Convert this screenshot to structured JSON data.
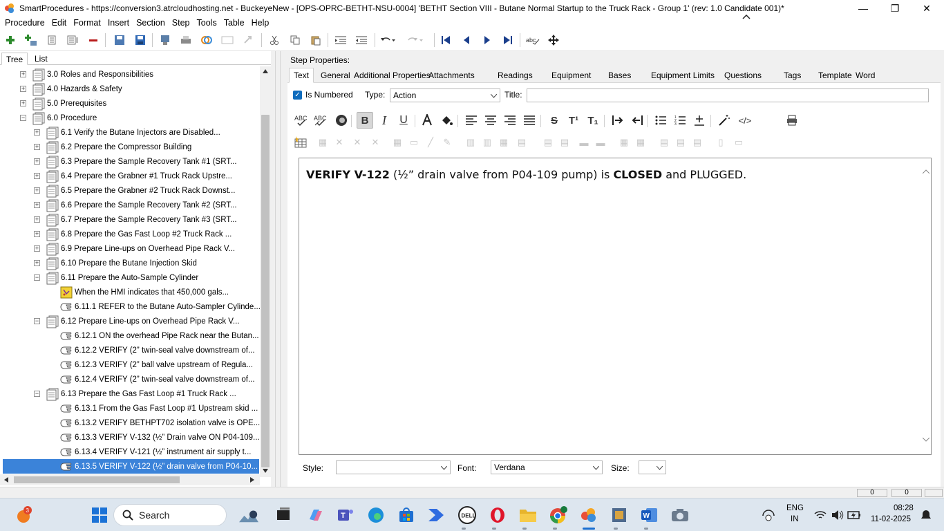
{
  "window": {
    "title": "SmartProcedures - https://conversion3.atrcloudhosting.net - BuckeyeNew - [OPS-OPRC-BETHT-NSU-0004] 'BETHT Section VIII - Butane Normal Startup to the Truck Rack - Group 1' (rev: 1.0 Candidate 001)*",
    "minimize": "—",
    "maximize": "❐",
    "close": "✕"
  },
  "menu": {
    "procedure": "Procedure",
    "edit": "Edit",
    "format": "Format",
    "insert": "Insert",
    "section": "Section",
    "step": "Step",
    "tools": "Tools",
    "table": "Table",
    "help": "Help"
  },
  "left_tabs": {
    "tree": "Tree",
    "list": "List"
  },
  "tree": {
    "rows": [
      {
        "label": "3.0 Roles and Responsibilities",
        "expander": "+",
        "icon": "section-icon"
      },
      {
        "label": "4.0 Hazards & Safety",
        "expander": "+",
        "icon": "section-icon"
      },
      {
        "label": "5.0 Prerequisites",
        "expander": "+",
        "icon": "section-icon"
      },
      {
        "label": "6.0 Procedure",
        "expander": "−",
        "icon": "section-icon"
      },
      {
        "label": "6.1 Verify the Butane Injectors are Disabled...",
        "expander": "+",
        "icon": "section-icon"
      },
      {
        "label": "6.2 Prepare the Compressor Building",
        "expander": "+",
        "icon": "section-icon"
      },
      {
        "label": "6.3 Prepare the Sample Recovery Tank #1 (SRT...",
        "expander": "+",
        "icon": "section-icon"
      },
      {
        "label": "6.4 Prepare the Grabner #1 Truck Rack Upstre...",
        "expander": "+",
        "icon": "section-icon"
      },
      {
        "label": "6.5 Prepare the Grabner #2 Truck Rack Downst...",
        "expander": "+",
        "icon": "section-icon"
      },
      {
        "label": "6.6 Prepare the Sample Recovery Tank #2 (SRT...",
        "expander": "+",
        "icon": "section-icon"
      },
      {
        "label": "6.7 Prepare the Sample Recovery Tank #3 (SRT...",
        "expander": "+",
        "icon": "section-icon"
      },
      {
        "label": "6.8 Prepare the Gas Fast Loop #2 Truck Rack ...",
        "expander": "+",
        "icon": "section-icon"
      },
      {
        "label": "6.9 Prepare Line-ups on Overhead Pipe Rack V...",
        "expander": "+",
        "icon": "section-icon"
      },
      {
        "label": "6.10 Prepare the Butane Injection Skid",
        "expander": "+",
        "icon": "section-icon"
      },
      {
        "label": "6.11 Prepare the Auto-Sample Cylinder",
        "expander": "−",
        "icon": "section-icon"
      },
      {
        "label": "When the HMI indicates that 450,000 gals...",
        "expander": "",
        "icon": "note-icon"
      },
      {
        "label": "6.11.1 REFER to the Butane Auto-Sampler Cylinde...",
        "expander": "",
        "icon": "step-icon"
      },
      {
        "label": "6.12 Prepare Line-ups on Overhead Pipe Rack V...",
        "expander": "−",
        "icon": "section-icon"
      },
      {
        "label": "6.12.1 ON the overhead Pipe Rack near the Butan...",
        "expander": "",
        "icon": "step-icon"
      },
      {
        "label": "6.12.2 VERIFY (2” twin-seal valve downstream of...",
        "expander": "",
        "icon": "step-icon"
      },
      {
        "label": "6.12.3 VERIFY (2” ball valve upstream of Regula...",
        "expander": "",
        "icon": "step-icon"
      },
      {
        "label": "6.12.4 VERIFY (2” twin-seal valve downstream of...",
        "expander": "",
        "icon": "step-icon"
      },
      {
        "label": "6.13 Prepare the Gas Fast Loop #1 Truck Rack ...",
        "expander": "−",
        "icon": "section-icon"
      },
      {
        "label": "6.13.1 From the Gas Fast Loop #1 Upstream skid ...",
        "expander": "",
        "icon": "step-icon"
      },
      {
        "label": "6.13.2 VERIFY BETHPT702 isolation valve is OPE...",
        "expander": "",
        "icon": "step-icon"
      },
      {
        "label": "6.13.3 VERIFY V-132 (½” Drain valve ON P04-109...",
        "expander": "",
        "icon": "step-icon"
      },
      {
        "label": "6.13.4 VERIFY V-121 (½” instrument air supply t...",
        "expander": "",
        "icon": "step-icon"
      },
      {
        "label": "6.13.5 VERIFY V-122 (½” drain valve from P04-10...",
        "expander": "",
        "icon": "step-icon",
        "selected": true
      }
    ]
  },
  "step_properties": {
    "heading": "Step Properties:",
    "tabs": [
      "Text",
      "General",
      "Additional Properties",
      "Attachments",
      "Readings",
      "Equipment",
      "Bases",
      "Equipment Limits",
      "Questions",
      "Tags",
      "Template",
      "Word"
    ],
    "active_tab": "Text",
    "is_numbered_label": "Is Numbered",
    "is_numbered": true,
    "type_label": "Type:",
    "type_value": "Action",
    "title_label": "Title:",
    "title_value": ""
  },
  "editor": {
    "text_parts": [
      {
        "text": "VERIFY V-122",
        "bold": true
      },
      {
        "text": " (½” drain valve from P04-109 pump) is ",
        "bold": false
      },
      {
        "text": "CLOSED",
        "bold": true
      },
      {
        "text": " and PLUGGED.",
        "bold": false
      }
    ]
  },
  "format_bar": {
    "bold": "B",
    "italic": "I",
    "underline": "U",
    "strike": "S",
    "superscript": "T¹",
    "subscript": "T₁",
    "html": "</>"
  },
  "style_bar": {
    "style_label": "Style:",
    "style_value": "",
    "font_label": "Font:",
    "font_value": "Verdana",
    "size_label": "Size:",
    "size_value": ""
  },
  "status": {
    "cell1": "0",
    "cell2": "0"
  },
  "taskbar": {
    "notification_count": "3",
    "search_placeholder": "Search",
    "language": "ENG",
    "region": "IN",
    "time": "08:28",
    "date": "11-02-2025"
  }
}
